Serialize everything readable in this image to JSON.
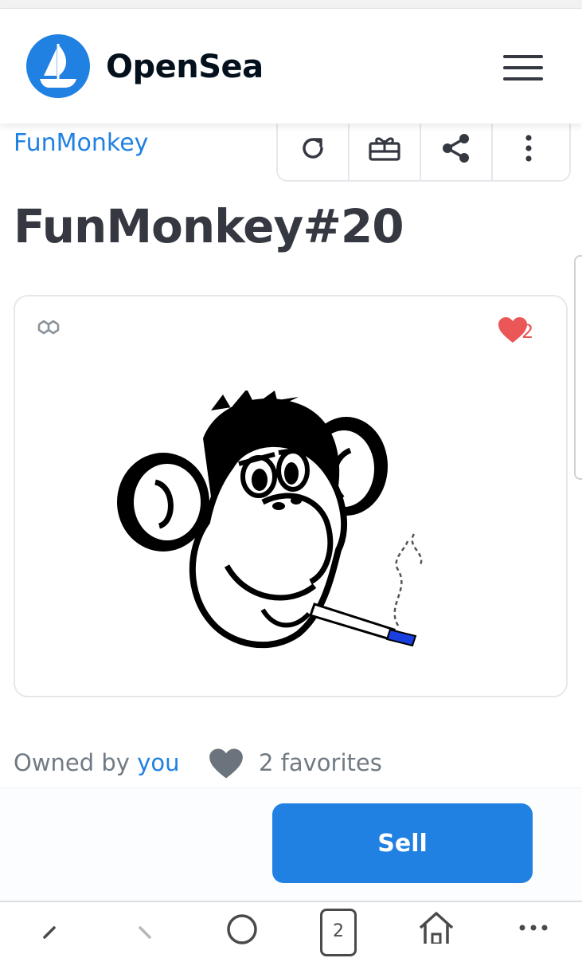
{
  "header": {
    "brand": "OpenSea",
    "logo_icon": "opensea-ship-icon",
    "menu_icon": "hamburger-menu-icon"
  },
  "asset": {
    "collection": "FunMonkey",
    "title": "FunMonkey#20",
    "favorite_count": "2",
    "chain_icon": "polygon-icon"
  },
  "toolbar": {
    "icons": [
      "refresh-icon",
      "gift-icon",
      "share-icon",
      "more-vertical-icon"
    ]
  },
  "owner": {
    "owned_by_label": "Owned by",
    "owner_name": "you",
    "favorites_text": "2 favorites"
  },
  "actions": {
    "sell_label": "Sell"
  },
  "browser_nav": {
    "tab_count": "2",
    "icons": [
      "back-icon",
      "forward-icon",
      "home-circle-icon",
      "tabs-icon",
      "home-icon",
      "more-horizontal-icon"
    ]
  },
  "colors": {
    "accent": "#2081e2",
    "heart": "#eb5757",
    "text_dark": "#353840",
    "text_muted": "#707a83"
  }
}
